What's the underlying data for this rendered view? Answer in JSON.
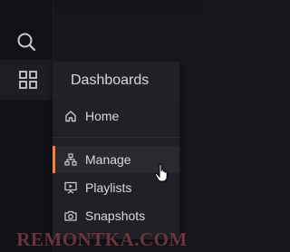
{
  "colors": {
    "background": "#17181c",
    "sidemenu": "#111217",
    "dropdown": "#1f2126",
    "text": "#d8d9da",
    "active_accent": "#f5813f"
  },
  "sidemenu": {
    "items": [
      {
        "name": "search",
        "icon": "search-icon"
      },
      {
        "name": "dashboards",
        "icon": "apps-grid-icon",
        "active": true
      }
    ]
  },
  "dropdown": {
    "header": "Dashboards",
    "items": [
      {
        "label": "Home",
        "icon": "home-icon"
      },
      {
        "label": "Manage",
        "icon": "sitemap-icon",
        "active": true
      },
      {
        "label": "Playlists",
        "icon": "presentation-play-icon"
      },
      {
        "label": "Snapshots",
        "icon": "camera-icon"
      }
    ]
  },
  "cursor": {
    "icon": "hand-pointer-icon"
  },
  "watermark": "REMONTKA.COM"
}
